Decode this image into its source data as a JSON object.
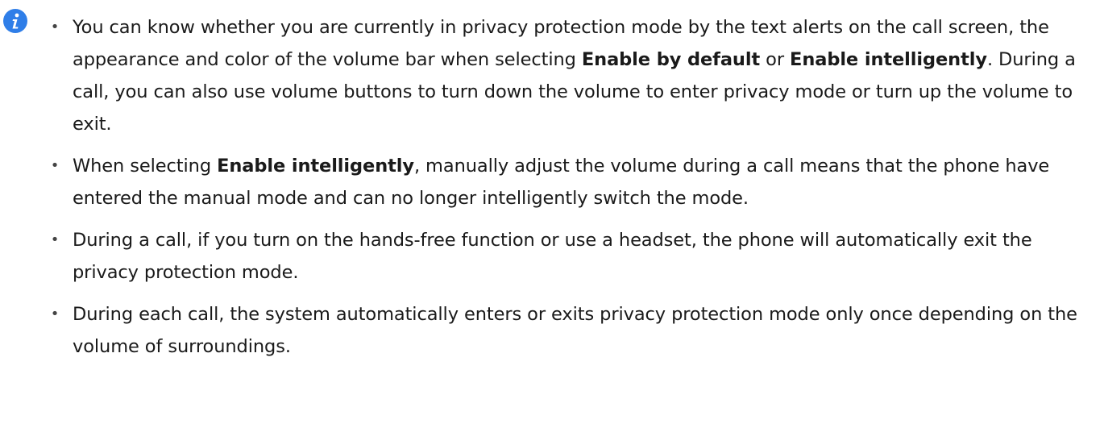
{
  "icon": {
    "name": "info-icon",
    "color": "#2f7ee8",
    "glyph": "i"
  },
  "items": [
    {
      "t1": "You can know whether you are currently in privacy protection mode by the text alerts on the call screen, the appearance and color of the volume bar when selecting ",
      "b1": "Enable by default",
      "t2": " or ",
      "b2": "Enable intelligently",
      "t3": ". During a call, you can also use volume buttons to turn down the volume to enter privacy mode or turn up the volume to exit."
    },
    {
      "t1": "When selecting ",
      "b1": "Enable intelligently",
      "t2": ", manually adjust the volume during a call means that the phone have entered the manual mode and can no longer intelligently switch the mode."
    },
    {
      "t1": "During a call, if you turn on the hands-free function or use a headset, the phone will automatically exit the privacy protection mode."
    },
    {
      "t1": "During each call, the system automatically enters or exits privacy protection mode only once depending on the volume of surroundings."
    }
  ]
}
